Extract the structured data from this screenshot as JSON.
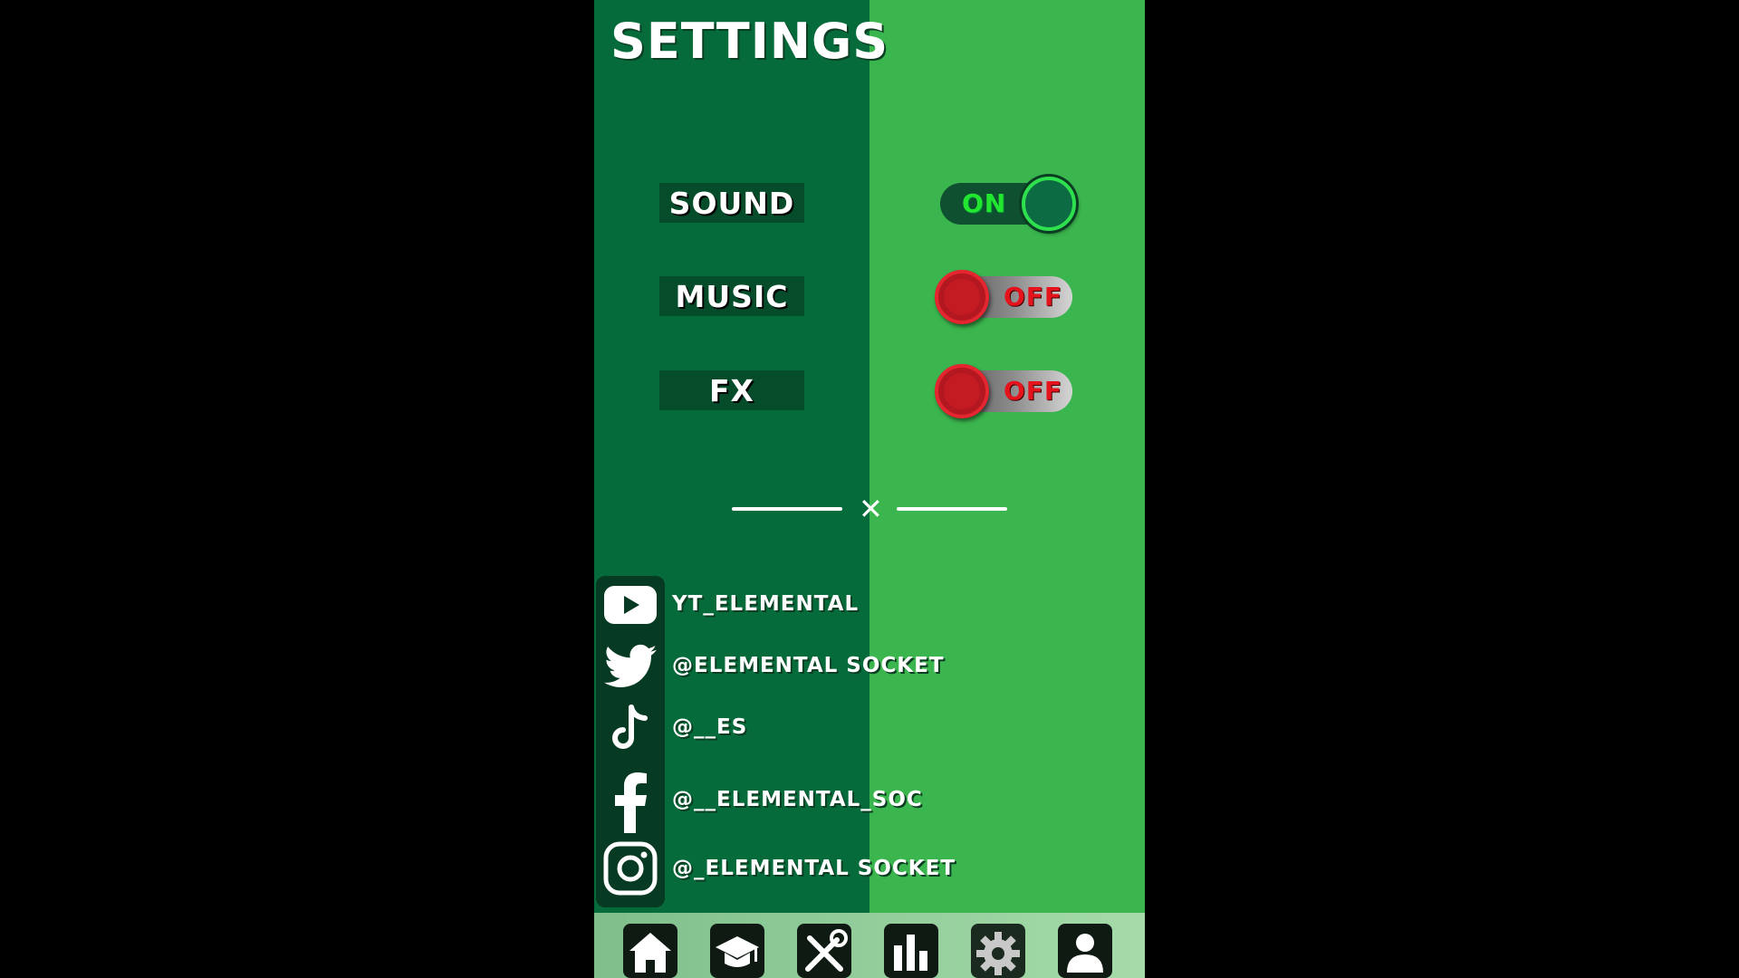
{
  "header": {
    "title": "SETTINGS"
  },
  "settings": [
    {
      "label": "SOUND",
      "state": "ON"
    },
    {
      "label": "MUSIC",
      "state": "OFF"
    },
    {
      "label": "FX",
      "state": "OFF"
    }
  ],
  "divider": {
    "symbol": "✕"
  },
  "socials": [
    {
      "icon": "youtube-icon",
      "handle": "YT_ELEMENTAL"
    },
    {
      "icon": "twitter-icon",
      "handle": "@ELEMENTAL SOCKET"
    },
    {
      "icon": "tiktok-icon",
      "handle": "@__ES"
    },
    {
      "icon": "facebook-icon",
      "handle": "@__ELEMENTAL_SOC"
    },
    {
      "icon": "instagram-icon",
      "handle": "@_ELEMENTAL SOCKET"
    }
  ],
  "nav": {
    "items": [
      "home-icon",
      "graduation-cap-icon",
      "tools-icon",
      "bar-chart-icon",
      "gear-icon",
      "user-icon"
    ],
    "active": "gear-icon"
  },
  "colors": {
    "dark_green": "#066b3a",
    "light_green": "#3bb54e",
    "on_green": "#23e630",
    "off_red": "#e5141c"
  }
}
